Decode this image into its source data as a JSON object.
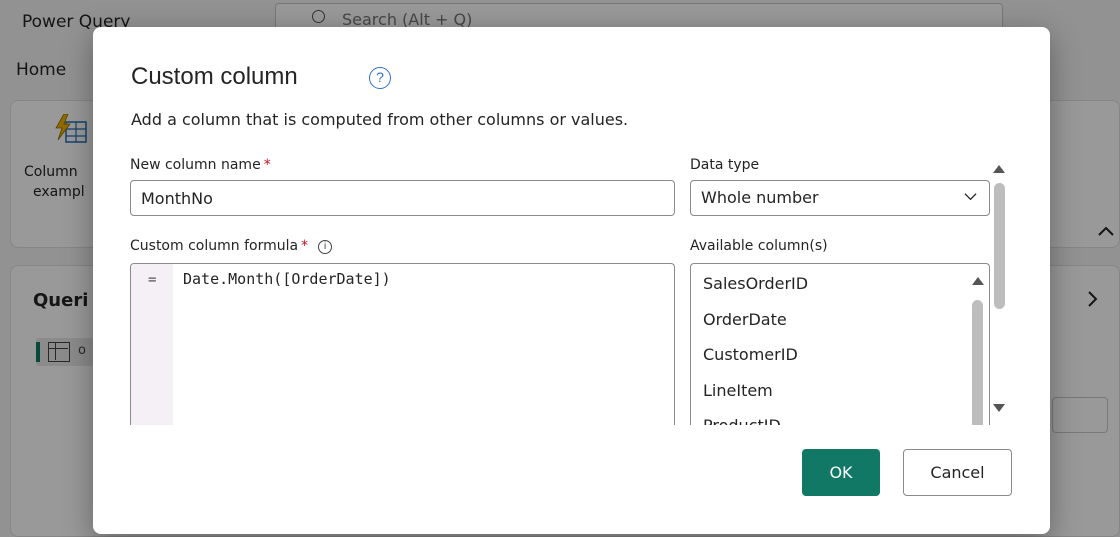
{
  "background": {
    "app_title": "Power Query",
    "search_placeholder": "Search (Alt + Q)",
    "tab_home": "Home",
    "ribbon_button_label": "Column from examples",
    "ribbon_button_label_line1": "Column",
    "ribbon_button_label_line2": "exampl",
    "queries_title": "Queri",
    "query_item_text": "o"
  },
  "dialog": {
    "title": "Custom column",
    "description": "Add a column that is computed from other columns or values.",
    "new_column_name": {
      "label": "New column name",
      "required_marker": "*",
      "value": "MonthNo"
    },
    "data_type": {
      "label": "Data type",
      "selected": "Whole number"
    },
    "formula": {
      "label": "Custom column formula",
      "required_marker": "*",
      "gutter_symbol": "=",
      "value": "Date.Month([OrderDate])"
    },
    "available_columns": {
      "label": "Available column(s)",
      "items": [
        "SalesOrderID",
        "OrderDate",
        "CustomerID",
        "LineItem",
        "ProductID"
      ]
    },
    "buttons": {
      "ok": "OK",
      "cancel": "Cancel"
    },
    "icons": {
      "help": "help-circle-icon",
      "info": "info-icon",
      "dropdown": "chevron-down-icon"
    }
  },
  "colors": {
    "accent": "#117865",
    "required": "#c50f1f",
    "help_icon": "#2f6fcf",
    "formula_gutter": "#f5f0f6"
  }
}
